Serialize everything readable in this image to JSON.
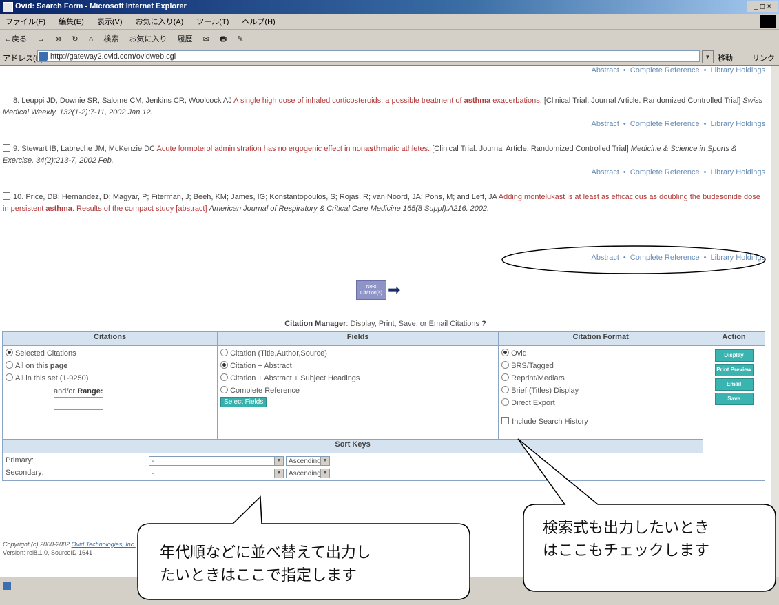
{
  "window": {
    "title": "Ovid: Search Form - Microsoft Internet Explorer",
    "controls": "_ ◻ ×"
  },
  "menu": [
    "ファイル(F)",
    "編集(E)",
    "表示(V)",
    "お気に入り(A)",
    "ツール(T)",
    "ヘルプ(H)"
  ],
  "toolbar": {
    "back": "←戻る",
    "forward": "→",
    "stop": "⊗",
    "refresh": "↻",
    "home": "⌂",
    "search": "検索",
    "favorites": "お気に入り",
    "history": "履歴",
    "mail": "✉",
    "print": "🖶",
    "edit": "✎"
  },
  "address": {
    "label": "アドレス(D)",
    "url": "http://gateway2.ovid.com/ovidweb.cgi",
    "go": "移動",
    "links": "リンク"
  },
  "citations": [
    {
      "id": "cite-7-tail",
      "links": [
        "Abstract",
        "Complete Reference",
        "Library Holdings"
      ]
    },
    {
      "id": "cite-8",
      "authors": "8. Leuppi JD, Downie SR, Salome CM, Jenkins CR, Woolcock AJ",
      "title_pre": "A single high dose of inhaled corticosteroids: a possible treatment of ",
      "title_bold": "asthma",
      "title_post": " exacerbations.",
      "pubtype": "[Clinical Trial. Journal Article. Randomized Controlled Trial]",
      "journal": "Swiss Medical Weekly. 132(1-2):7-11, 2002 Jan 12.",
      "links": [
        "Abstract",
        "Complete Reference",
        "Library Holdings"
      ]
    },
    {
      "id": "cite-9",
      "authors": "9. Stewart IB, Labreche JM, McKenzie DC",
      "title_pre": "Acute formoterol administration has no ergogenic effect in non",
      "title_bold": "asthma",
      "title_post": "tic athletes.",
      "pubtype": "[Clinical Trial. Journal Article. Randomized Controlled Trial]",
      "journal": "Medicine & Science in Sports & Exercise. 34(2):213-7, 2002 Feb.",
      "links": [
        "Abstract",
        "Complete Reference",
        "Library Holdings"
      ]
    },
    {
      "id": "cite-10",
      "authors": "10. Price, DB; Hernandez, D; Magyar, P; Fiterman, J; Beeh, KM; James, IG; Konstantopoulos, S; Rojas, R; van Noord, JA; Pons, M; and Leff, JA",
      "title_pre": "Adding montelukast is at least as efficacious as doubling the budesonide dose in persistent ",
      "title_bold": "asthma",
      "title_post": ". Results of the compact study [abstract]",
      "journal": "American Journal of Respiratory & Critical Care Medicine 165(8 Suppl):A216. 2002.",
      "links": [
        "Abstract",
        "Complete Reference",
        "Library Holdings"
      ]
    }
  ],
  "next_button": "Next Citation(s)",
  "citation_manager": {
    "label": "Citation Manager",
    "desc": ": Display, Print, Save, or Email Citations",
    "help": "?",
    "headers": [
      "Citations",
      "Fields",
      "Citation Format",
      "Action"
    ],
    "citations_options": [
      "Selected Citations",
      "All on this ",
      "All in this set (1-9250)"
    ],
    "page_bold": "page",
    "range_label": "and/or ",
    "range_bold": "Range:",
    "fields_options": [
      "Citation (Title,Author,Source)",
      "Citation + Abstract",
      "Citation + Abstract + Subject Headings",
      "Complete Reference"
    ],
    "select_fields": "Select Fields",
    "format_options": [
      "Ovid",
      "BRS/Tagged",
      "Reprint/Medlars",
      "Brief (Titles) Display",
      "Direct Export"
    ],
    "include_history": "Include Search History",
    "actions": [
      "Display",
      "Print Preview",
      "Email",
      "Save"
    ],
    "sort_keys": "Sort Keys",
    "primary": "Primary:",
    "secondary": "Secondary:",
    "sort_value": "-",
    "order_value": "Ascending"
  },
  "footer": {
    "copyright": "Copyright (c) 2000-2002 ",
    "copyright_link": "Ovid Technologies, Inc.",
    "version": "Version: rel8.1.0, SourceID 1641"
  },
  "callouts": {
    "left": "年代順などに並べ替えて出力し\nたいときはここで指定します",
    "right": "検索式も出力したいとき\nはここもチェックします"
  },
  "colors": {
    "title_link": "#b33a3a",
    "nav_link": "#6a8fb8",
    "table_header": "#d5e3f1",
    "action_button": "#3ab4b0"
  }
}
